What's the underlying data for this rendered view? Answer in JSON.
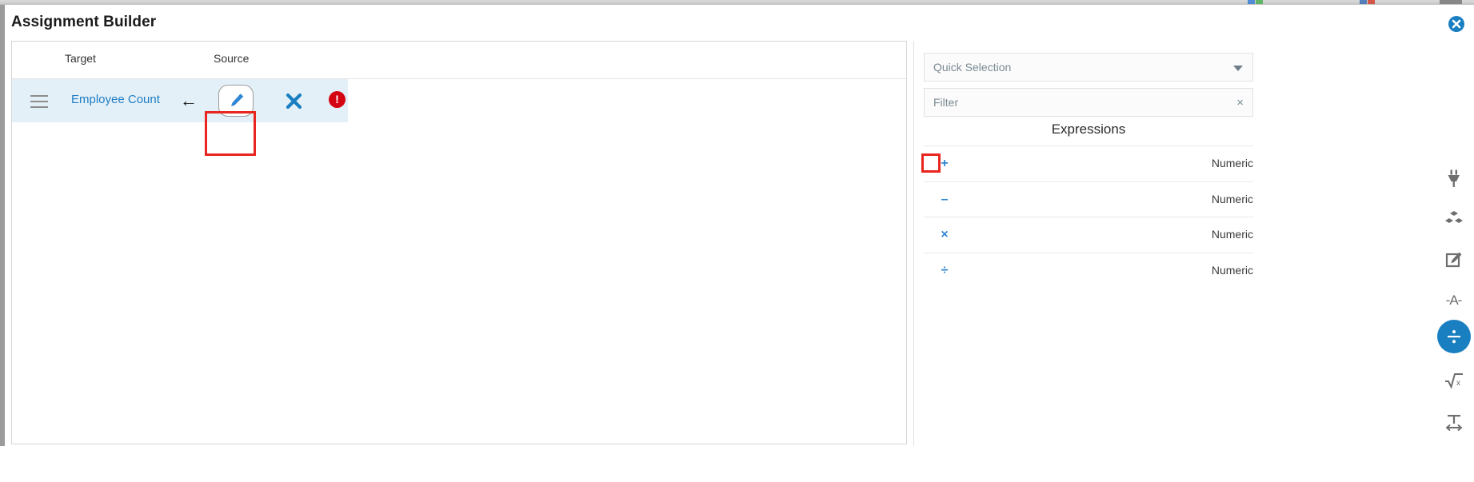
{
  "window": {
    "title": "Assignment Builder",
    "close_icon": "close-circle-icon"
  },
  "mapping": {
    "columns": {
      "target": "Target",
      "source": "Source"
    },
    "rows": [
      {
        "drag_handle_icon": "drag-handle-icon",
        "target": "Employee Count",
        "direction_icon": "arrow-left-icon",
        "edit_icon": "pencil-icon",
        "remove_icon": "close-x-icon",
        "status_icon": "error-exclamation-icon",
        "status_symbol": "!"
      }
    ]
  },
  "side_panel": {
    "quick_selection": {
      "placeholder": "Quick Selection",
      "value": "",
      "dropdown_icon": "chevron-down-icon"
    },
    "filter": {
      "placeholder": "Filter",
      "value": "",
      "clear_icon": "clear-x-icon",
      "clear_symbol": "×"
    },
    "section_title": "Expressions",
    "expressions": [
      {
        "operator": "+",
        "icon": "plus-icon",
        "type": "Numeric"
      },
      {
        "operator": "–",
        "icon": "minus-icon",
        "type": "Numeric"
      },
      {
        "operator": "×",
        "icon": "multiply-icon",
        "type": "Numeric"
      },
      {
        "operator": "÷",
        "icon": "divide-icon",
        "type": "Numeric"
      }
    ]
  },
  "icon_rail": [
    {
      "icon": "plug-icon",
      "active": false
    },
    {
      "icon": "cubes-icon",
      "active": false
    },
    {
      "icon": "edit-square-icon",
      "active": false
    },
    {
      "icon": "text-a-icon",
      "label": "-A-",
      "active": false
    },
    {
      "icon": "divide-icon",
      "label": "÷",
      "active": true
    },
    {
      "icon": "square-root-icon",
      "label": "√x",
      "active": false
    },
    {
      "icon": "text-width-icon",
      "active": false
    }
  ],
  "colors": {
    "accent_blue": "#1a7fc1",
    "link_blue": "#1f7ec4",
    "row_highlight": "#e4f0f8",
    "error_red": "#d40511",
    "annotation_red": "#e8251e",
    "operator_blue": "#2f86d3"
  }
}
